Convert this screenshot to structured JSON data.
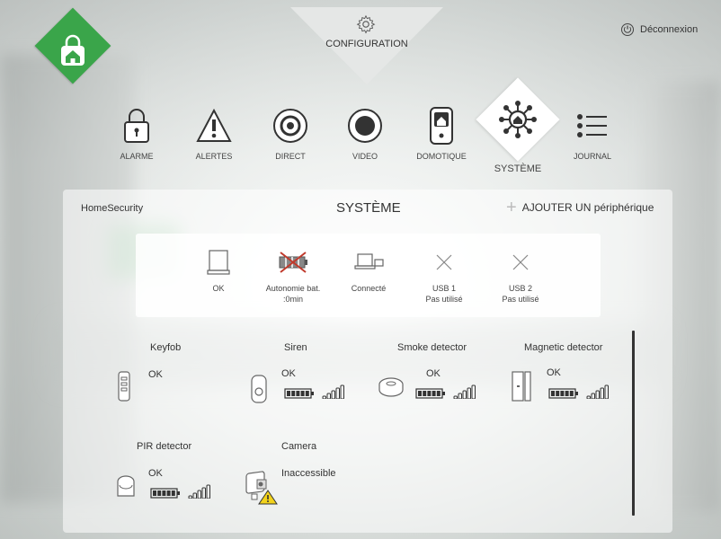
{
  "header": {
    "config_label": "CONFIGURATION",
    "logout_label": "Déconnexion"
  },
  "nav": [
    {
      "label": "ALARME",
      "icon": "lock-icon"
    },
    {
      "label": "ALERTES",
      "icon": "warning-icon"
    },
    {
      "label": "DIRECT",
      "icon": "camera-lens-icon"
    },
    {
      "label": "VIDEO",
      "icon": "record-icon"
    },
    {
      "label": "DOMOTIQUE",
      "icon": "smart-switch-icon"
    },
    {
      "label": "SYSTÈME",
      "icon": "home-network-icon",
      "active": true
    },
    {
      "label": "JOURNAL",
      "icon": "list-icon"
    }
  ],
  "panel": {
    "brand": "HomeSecurity",
    "title": "SYSTÈME",
    "add_label": "AJOUTER UN périphérique"
  },
  "status": [
    {
      "label": "OK",
      "icon": "panel-icon"
    },
    {
      "label": "Autonomie bat.",
      "sub": ":0min",
      "icon": "battery-crossed-icon"
    },
    {
      "label": "Connecté",
      "icon": "network-icon"
    },
    {
      "label": "USB 1",
      "sub": "Pas utilisé",
      "icon": "usb-off-icon"
    },
    {
      "label": "USB 2",
      "sub": "Pas utilisé",
      "icon": "usb-off-icon"
    }
  ],
  "devices": [
    {
      "name": "Keyfob",
      "status": "OK",
      "icon": "keyfob-icon"
    },
    {
      "name": "Siren",
      "status": "OK",
      "icon": "siren-icon"
    },
    {
      "name": "Smoke detector",
      "status": "OK",
      "icon": "smoke-detector-icon"
    },
    {
      "name": "Magnetic detector",
      "status": "OK",
      "icon": "magnetic-detector-icon"
    },
    {
      "name": "PIR detector",
      "status": "OK",
      "icon": "pir-detector-icon"
    },
    {
      "name": "Camera",
      "status": "Inaccessible",
      "icon": "camera-warning-icon"
    }
  ],
  "colors": {
    "brand_green": "#3aa54a",
    "warning_yellow": "#f2d21b",
    "error_red": "#c0392b"
  }
}
